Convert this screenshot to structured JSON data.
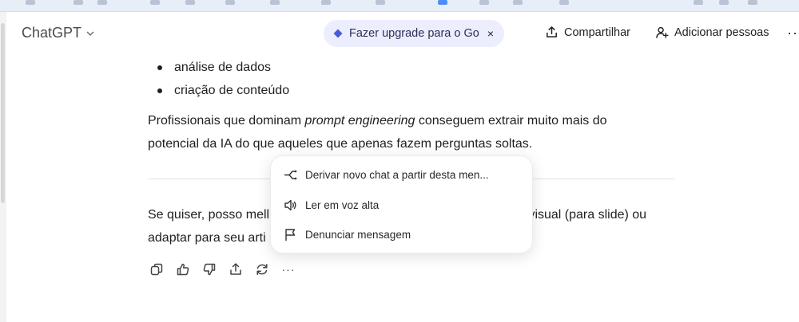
{
  "header": {
    "model_label": "ChatGPT",
    "upgrade_label": "Fazer upgrade para o Go",
    "upgrade_close": "×",
    "share_label": "Compartilhar",
    "add_people_label": "Adicionar pessoas",
    "more_label": "···"
  },
  "message": {
    "bullets": [
      "análise de dados",
      "criação de conteúdo"
    ],
    "para1_before": "Profissionais que dominam ",
    "para1_em": "prompt engineering",
    "para1_after": " conseguem extrair muito mais do",
    "para1_line2": "potencial da IA do que aqueles que apenas fazem perguntas soltas.",
    "para2_line1_left": "Se quiser, posso mell",
    "para2_line1_right": "s visual (para slide) ou",
    "para2_line2_left": "adaptar para seu arti"
  },
  "actions": {
    "icons": [
      "copy-icon",
      "thumbs-up-icon",
      "thumbs-down-icon",
      "share-icon",
      "regenerate-icon",
      "more-icon"
    ],
    "more_label": "···"
  },
  "context_menu": {
    "items": [
      {
        "label": "Derivar novo chat a partir desta men...",
        "icon": "branch-icon"
      },
      {
        "label": "Ler em voz alta",
        "icon": "speaker-icon"
      },
      {
        "label": "Denunciar mensagem",
        "icon": "flag-icon"
      }
    ]
  },
  "colors": {
    "upgrade_bg": "#eceefe",
    "upgrade_gem": "#4b5bd7",
    "text": "#1f1f1f"
  }
}
